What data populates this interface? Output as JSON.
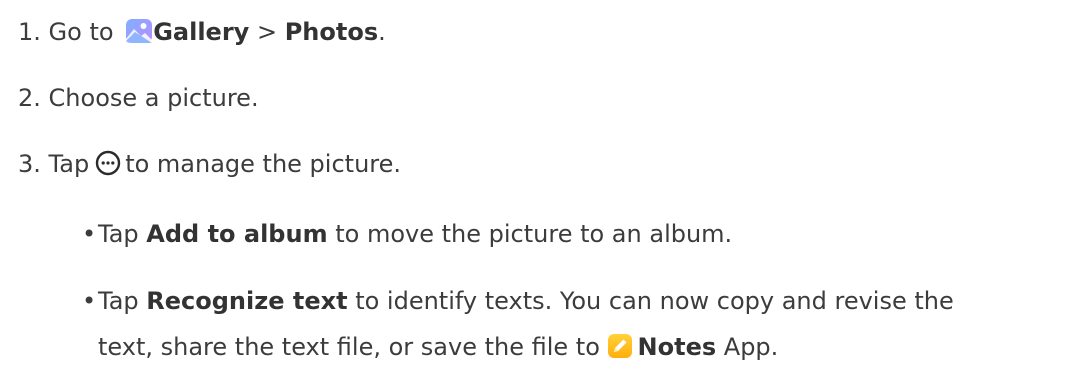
{
  "steps": [
    {
      "number": "1.",
      "prefix": "Go to",
      "app": "Gallery",
      "separator": ">",
      "target": "Photos",
      "end": "."
    },
    {
      "number": "2.",
      "text": "Choose a picture."
    },
    {
      "number": "3.",
      "prefix": "Tap",
      "suffix": "to manage the picture."
    }
  ],
  "bullets": [
    {
      "marker": "•",
      "prefix": "Tap",
      "bold": "Add to album",
      "suffix": "to move the picture to an album."
    },
    {
      "marker": "•",
      "prefix": "Tap",
      "bold": "Recognize text",
      "suffix": "to identify texts. You can now copy and revise the",
      "continuation": "text, share the text file, or save the file to",
      "app": "Notes",
      "end": "App."
    }
  ],
  "icons": {
    "gallery": "gallery-app-icon",
    "more": "more-options-icon",
    "notes": "notes-app-icon"
  },
  "colors": {
    "text": "#3c3c3c",
    "bold": "#333333",
    "gallery_gradient_start": "#7fa8ff",
    "gallery_gradient_end": "#c28bff",
    "notes_yellow": "#ffbe1a"
  }
}
